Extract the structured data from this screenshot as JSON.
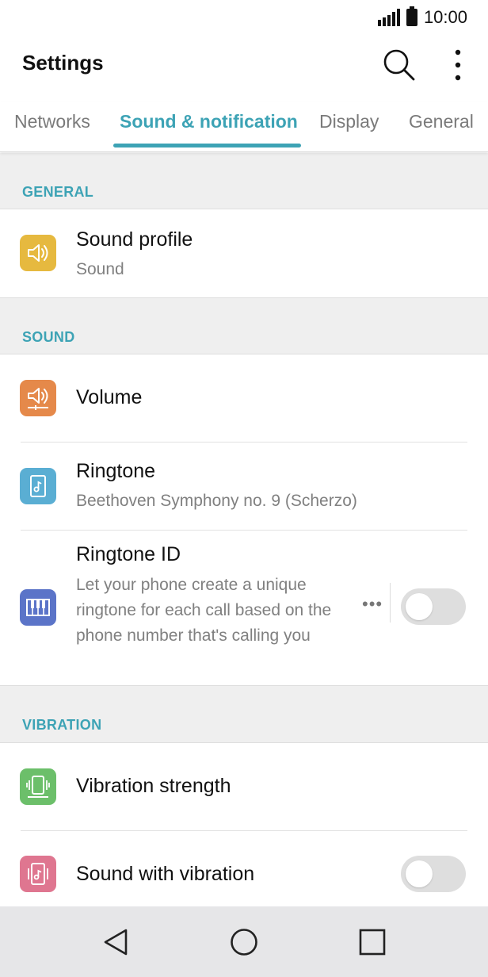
{
  "status_bar": {
    "time": "10:00"
  },
  "app_bar": {
    "title": "Settings",
    "search_icon": "search-icon",
    "menu_icon": "more-vert-icon"
  },
  "tabs": [
    {
      "label": "Networks",
      "selected": false
    },
    {
      "label": "Sound & notification",
      "selected": true
    },
    {
      "label": "Display",
      "selected": false
    },
    {
      "label": "General",
      "selected": false
    }
  ],
  "sections": {
    "general": {
      "header": "GENERAL",
      "items": [
        {
          "title": "Sound profile",
          "subtitle": "Sound",
          "icon": "speaker-icon",
          "icon_color": "#e6b93f"
        }
      ]
    },
    "sound": {
      "header": "SOUND",
      "items": [
        {
          "title": "Volume",
          "icon": "volume-icon",
          "icon_color": "#e5894a"
        },
        {
          "title": "Ringtone",
          "subtitle": "Beethoven Symphony no. 9 (Scherzo)",
          "icon": "music-file-icon",
          "icon_color": "#5aaed3"
        },
        {
          "title": "Ringtone ID",
          "subtitle": "Let your phone create a unique ringtone for each call based on the phone number that's calling you",
          "icon": "piano-keys-icon",
          "icon_color": "#5b74c8",
          "more": "•••",
          "toggle_on": false
        }
      ]
    },
    "vibration": {
      "header": "VIBRATION",
      "items": [
        {
          "title": "Vibration strength",
          "icon": "vibrate-phone-icon",
          "icon_color": "#6cbf6a"
        },
        {
          "title": "Sound with vibration",
          "icon": "sound-vibrate-icon",
          "icon_color": "#df7690",
          "toggle_on": false
        }
      ]
    }
  },
  "nav_bar": {
    "back_icon": "back-icon",
    "home_icon": "home-icon",
    "recents_icon": "recents-icon"
  },
  "colors": {
    "accent": "#3da3b5",
    "section_bg": "#efefef",
    "nav_bg": "#e6e6e8"
  }
}
